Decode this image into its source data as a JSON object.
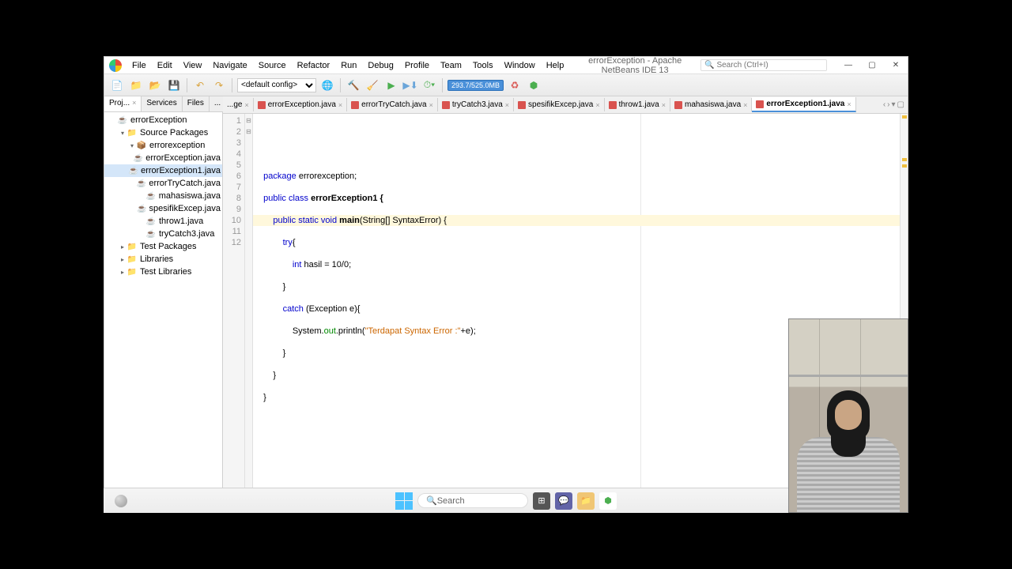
{
  "window": {
    "title": "errorException - Apache NetBeans IDE 13",
    "search_placeholder": "Search (Ctrl+I)"
  },
  "menu": [
    "File",
    "Edit",
    "View",
    "Navigate",
    "Source",
    "Refactor",
    "Run",
    "Debug",
    "Profile",
    "Team",
    "Tools",
    "Window",
    "Help"
  ],
  "toolbar": {
    "config": "<default config>",
    "memory": "293.7/525.0MB"
  },
  "sidebar": {
    "tabs": [
      {
        "label": "Proj...",
        "active": true,
        "closable": true
      },
      {
        "label": "Services",
        "active": false
      },
      {
        "label": "Files",
        "active": false
      },
      {
        "label": "...",
        "active": false
      }
    ],
    "tree": [
      {
        "depth": 0,
        "expand": "",
        "icon": "project",
        "label": "errorException"
      },
      {
        "depth": 1,
        "expand": "v",
        "icon": "folder",
        "label": "Source Packages"
      },
      {
        "depth": 2,
        "expand": "v",
        "icon": "pkg",
        "label": "errorexception"
      },
      {
        "depth": 3,
        "expand": "",
        "icon": "java",
        "label": "errorException.java"
      },
      {
        "depth": 3,
        "expand": "",
        "icon": "java",
        "label": "errorException1.java",
        "selected": true
      },
      {
        "depth": 3,
        "expand": "",
        "icon": "java",
        "label": "errorTryCatch.java"
      },
      {
        "depth": 3,
        "expand": "",
        "icon": "java",
        "label": "mahasiswa.java"
      },
      {
        "depth": 3,
        "expand": "",
        "icon": "java",
        "label": "spesifikExcep.java"
      },
      {
        "depth": 3,
        "expand": "",
        "icon": "java",
        "label": "throw1.java"
      },
      {
        "depth": 3,
        "expand": "",
        "icon": "java",
        "label": "tryCatch3.java"
      },
      {
        "depth": 1,
        "expand": ">",
        "icon": "folder",
        "label": "Test Packages"
      },
      {
        "depth": 1,
        "expand": ">",
        "icon": "folder",
        "label": "Libraries"
      },
      {
        "depth": 1,
        "expand": ">",
        "icon": "folder",
        "label": "Test Libraries"
      }
    ]
  },
  "editor": {
    "tabs": [
      {
        "label": "...ge",
        "active": false,
        "noicon": true
      },
      {
        "label": "errorException.java",
        "active": false
      },
      {
        "label": "errorTryCatch.java",
        "active": false
      },
      {
        "label": "tryCatch3.java",
        "active": false
      },
      {
        "label": "spesifikExcep.java",
        "active": false
      },
      {
        "label": "throw1.java",
        "active": false
      },
      {
        "label": "mahasiswa.java",
        "active": false
      },
      {
        "label": "errorException1.java",
        "active": true
      }
    ],
    "code": {
      "l1": {
        "a": "package",
        "b": " errorexception;"
      },
      "l2": {
        "a": "public class",
        "b": " errorException1 {"
      },
      "l3": {
        "a": "public static void",
        "b": " main",
        "c": "(String[] SyntaxError) ",
        "d": "{"
      },
      "l4": {
        "a": "try",
        "b": "{"
      },
      "l5": {
        "a": "int",
        "b": " hasil = 10/0;"
      },
      "l6": {
        "a": "}"
      },
      "l7": {
        "a": "catch",
        "b": " (Exception e){"
      },
      "l8": {
        "a": "System.",
        "b": "out",
        "c": ".println(",
        "d": "\"Terdapat Syntax Error :\"",
        "e": "+e);"
      },
      "l9": {
        "a": "}"
      },
      "l10": {
        "a": "}"
      },
      "l11": {
        "a": "}"
      }
    },
    "highlight_line": 10,
    "line_count": 12
  },
  "taskbar": {
    "search": "Search"
  }
}
